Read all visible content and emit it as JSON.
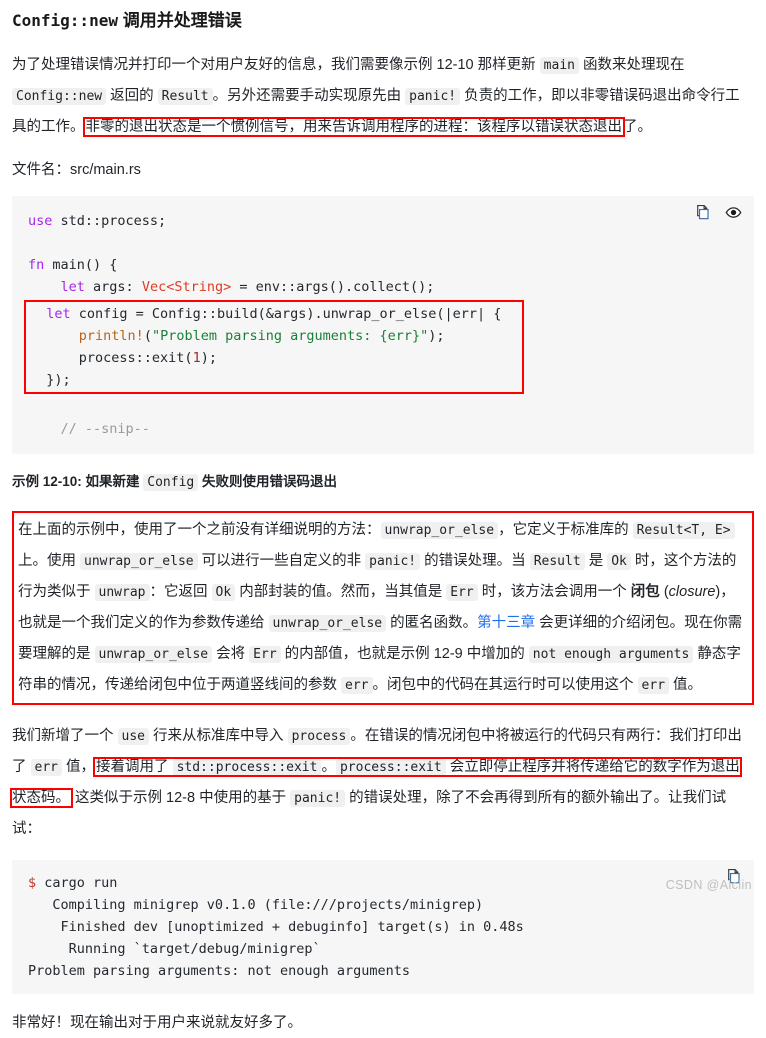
{
  "heading": {
    "mono_part": "Config::new",
    "text_part": " 调用并处理错误"
  },
  "intro_paragraph": {
    "seg1": "为了处理错误情况并打印一个对用户友好的信息，我们需要像示例 12-10 那样更新 ",
    "code1": "main",
    "seg2": " 函数来处理现在 ",
    "code2": "Config::new",
    "seg3": " 返回的 ",
    "code3": "Result",
    "seg4": "。另外还需要手动实现原先由 ",
    "code4": "panic!",
    "seg5": " 负责的工作，即以非零错误码退出命令行工具的工作。",
    "highlighted": "非零的退出状态是一个惯例信号，用来告诉调用程序的进程：该程序以错误状态退出",
    "seg6": "了。"
  },
  "filename_label": "文件名：",
  "filename_value": "src/main.rs",
  "code_block": {
    "actions": {
      "copy_label": "copy-icon",
      "preview_label": "eye-icon"
    },
    "line_use_kw": "use",
    "line_use_rest": " std::process;",
    "line_blank1": "",
    "line_fn_kw": "fn",
    "line_fn_rest": " main() {",
    "line_let1_indent": "    ",
    "line_let1_kw": "let",
    "line_let1_mid": " args: ",
    "line_let1_type": "Vec<String>",
    "line_let1_rest": " = env::args().collect();",
    "line_blank2": "",
    "boxed": {
      "l1_indent": "  ",
      "l1_kw": "let",
      "l1_rest": " config = Config::build(&args).unwrap_or_else(|err| {",
      "l2_indent": "      ",
      "l2_macro": "println!",
      "l2_open": "(",
      "l2_str": "\"Problem parsing arguments: {err}\"",
      "l2_close": ");",
      "l3": "      process::exit(",
      "l3_num": "1",
      "l3_end": ");",
      "l4": "  });"
    },
    "line_blank3": "",
    "line_comment": "    // --snip--"
  },
  "caption": {
    "seg1": "示例 12-10: 如果新建 ",
    "code1": "Config",
    "seg2": " 失败则使用错误码退出"
  },
  "boxed_paragraph": {
    "seg1": "在上面的示例中，使用了一个之前没有详细说明的方法：",
    "code1": "unwrap_or_else",
    "seg2": "，它定义于标准库的 ",
    "code2": "Result<T, E>",
    "seg3": " 上。使用 ",
    "code3": "unwrap_or_else",
    "seg4": " 可以进行一些自定义的非 ",
    "code4": "panic!",
    "seg5": " 的错误处理。当 ",
    "code5": "Result",
    "seg6": " 是 ",
    "code6": "Ok",
    "seg7": " 时，这个方法的行为类似于 ",
    "code7": "unwrap",
    "seg8": "：它返回 ",
    "code8": "Ok",
    "seg9": " 内部封装的值。然而，当其值是 ",
    "code9": "Err",
    "seg10": " 时，该方法会调用一个 ",
    "bold1": "闭包",
    "seg11": " (",
    "ital1": "closure",
    "seg12": ")，也就是一个我们定义的作为参数传递给 ",
    "code10": "unwrap_or_else",
    "seg13": " 的匿名函数。",
    "link1": "第十三章",
    "seg14": " 会更详细的介绍闭包。现在你需要理解的是 ",
    "code11": "unwrap_or_else",
    "seg15": " 会将 ",
    "code12": "Err",
    "seg16": " 的内部值，也就是示例 12-9 中增加的 ",
    "code13": "not enough arguments",
    "seg17": " 静态字符串的情况，传递给闭包中位于两道竖线间的参数 ",
    "code14": "err",
    "seg18": "。闭包中的代码在其运行时可以使用这个 ",
    "code15": "err",
    "seg19": " 值。"
  },
  "process_paragraph": {
    "seg1": "我们新增了一个 ",
    "code1": "use",
    "seg2": " 行来从标准库中导入 ",
    "code2": "process",
    "seg3": "。在错误的情况闭包中将被运行的代码只有两行：我们打印出了 ",
    "code3": "err",
    "seg4": " 值，",
    "hl_seg1": "接着调用了 ",
    "hl_code1": "std::process::exit",
    "hl_seg2": "。",
    "hl_code2": "process::exit",
    "hl_seg3": " 会立即停止程序并将传递给它的数字作为退出状态码。",
    "seg5": " 这类似于示例 12-8 中使用的基于 ",
    "code4": "panic!",
    "seg6": " 的错误处理，除了不会再得到所有的额外输出了。让我们试试："
  },
  "terminal": {
    "prompt": "$",
    "command": " cargo run",
    "line1": "   Compiling minigrep v0.1.0 (file:///projects/minigrep)",
    "line2": "    Finished dev [unoptimized + debuginfo] target(s) in 0.48s",
    "line3": "     Running `target/debug/minigrep`",
    "line4": "Problem parsing arguments: not enough arguments",
    "copy_label": "copy-icon"
  },
  "closing_paragraph": "非常好！现在输出对于用户来说就友好多了。",
  "watermark": "CSDN @Aiclin",
  "colors": {
    "annotation_red": "#ff0000",
    "link_blue": "#1f6feb",
    "code_bg": "#f6f6f6",
    "inline_code_bg": "#f0f0f0"
  }
}
